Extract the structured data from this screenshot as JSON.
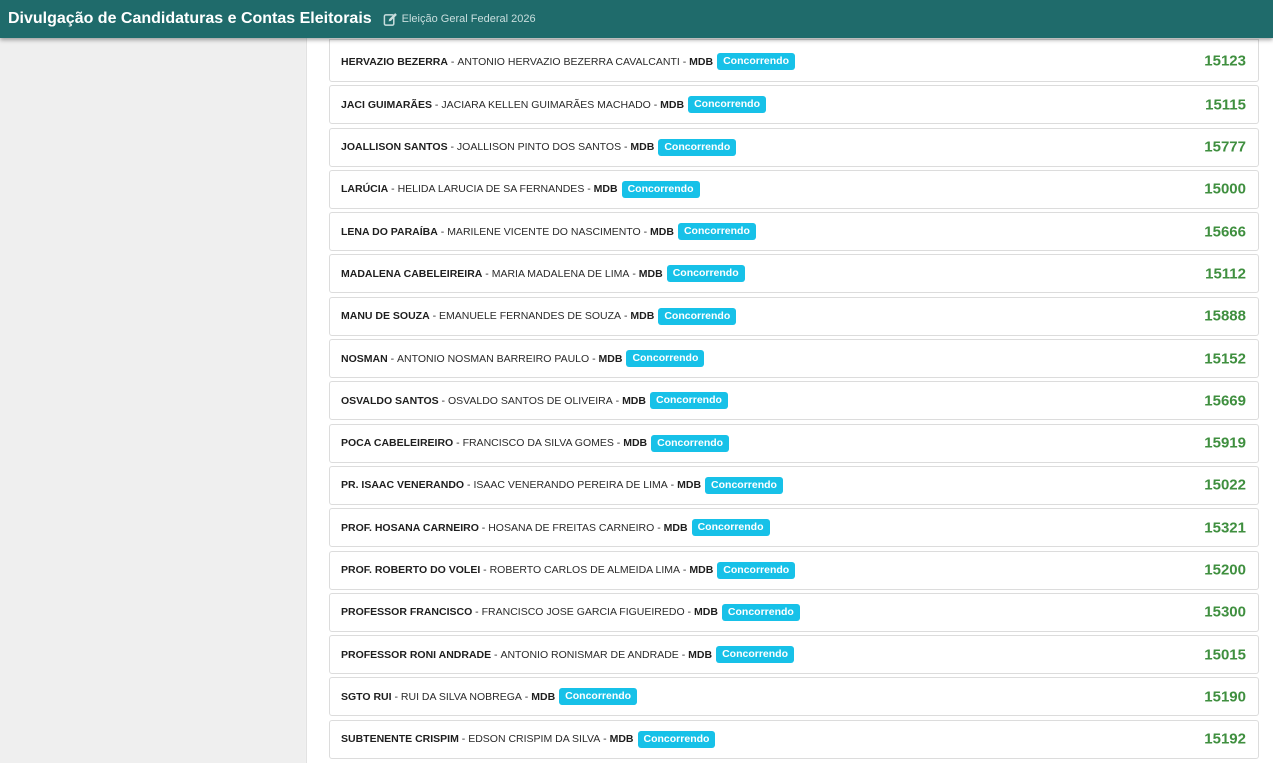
{
  "header": {
    "app_title": "Divulgação de Candidaturas e Contas Eleitorais",
    "election_label": "Eleição Geral Federal 2026",
    "election_icon": "edit-icon"
  },
  "colors": {
    "header_bg": "#1f6b6b",
    "badge_bg": "#17c1e8",
    "number_color": "#3f8f3f"
  },
  "candidates": [
    {
      "urn_name": "HERVAZIO BEZERRA",
      "full_name": "ANTONIO HERVAZIO BEZERRA CAVALCANTI",
      "party": "MDB",
      "status": "Concorrendo",
      "number": "15123"
    },
    {
      "urn_name": "JACI GUIMARÃES",
      "full_name": "JACIARA KELLEN GUIMARÃES MACHADO",
      "party": "MDB",
      "status": "Concorrendo",
      "number": "15115"
    },
    {
      "urn_name": "JOALLISON SANTOS",
      "full_name": "JOALLISON PINTO DOS SANTOS",
      "party": "MDB",
      "status": "Concorrendo",
      "number": "15777"
    },
    {
      "urn_name": "LARÚCIA",
      "full_name": "HELIDA LARUCIA DE SA FERNANDES",
      "party": "MDB",
      "status": "Concorrendo",
      "number": "15000"
    },
    {
      "urn_name": "LENA DO PARAÍBA",
      "full_name": "MARILENE VICENTE DO NASCIMENTO",
      "party": "MDB",
      "status": "Concorrendo",
      "number": "15666"
    },
    {
      "urn_name": "MADALENA CABELEIREIRA",
      "full_name": "MARIA MADALENA DE LIMA",
      "party": "MDB",
      "status": "Concorrendo",
      "number": "15112"
    },
    {
      "urn_name": "MANU DE SOUZA",
      "full_name": "EMANUELE FERNANDES DE SOUZA",
      "party": "MDB",
      "status": "Concorrendo",
      "number": "15888"
    },
    {
      "urn_name": "NOSMAN",
      "full_name": "ANTONIO NOSMAN BARREIRO PAULO",
      "party": "MDB",
      "status": "Concorrendo",
      "number": "15152"
    },
    {
      "urn_name": "OSVALDO SANTOS",
      "full_name": "OSVALDO SANTOS DE OLIVEIRA",
      "party": "MDB",
      "status": "Concorrendo",
      "number": "15669"
    },
    {
      "urn_name": "POCA CABELEIREIRO",
      "full_name": "FRANCISCO DA SILVA GOMES",
      "party": "MDB",
      "status": "Concorrendo",
      "number": "15919"
    },
    {
      "urn_name": "PR. ISAAC VENERANDO",
      "full_name": "ISAAC VENERANDO PEREIRA DE LIMA",
      "party": "MDB",
      "status": "Concorrendo",
      "number": "15022"
    },
    {
      "urn_name": "PROF. HOSANA CARNEIRO",
      "full_name": "HOSANA DE FREITAS CARNEIRO",
      "party": "MDB",
      "status": "Concorrendo",
      "number": "15321"
    },
    {
      "urn_name": "PROF. ROBERTO DO VOLEI",
      "full_name": "ROBERTO CARLOS DE ALMEIDA LIMA",
      "party": "MDB",
      "status": "Concorrendo",
      "number": "15200"
    },
    {
      "urn_name": "PROFESSOR FRANCISCO",
      "full_name": "FRANCISCO JOSE GARCIA FIGUEIREDO",
      "party": "MDB",
      "status": "Concorrendo",
      "number": "15300"
    },
    {
      "urn_name": "PROFESSOR RONI ANDRADE",
      "full_name": "ANTONIO RONISMAR DE ANDRADE",
      "party": "MDB",
      "status": "Concorrendo",
      "number": "15015"
    },
    {
      "urn_name": "SGTO RUI",
      "full_name": "RUI DA SILVA NOBREGA",
      "party": "MDB",
      "status": "Concorrendo",
      "number": "15190"
    },
    {
      "urn_name": "SUBTENENTE CRISPIM",
      "full_name": "EDSON CRISPIM DA SILVA",
      "party": "MDB",
      "status": "Concorrendo",
      "number": "15192"
    }
  ]
}
